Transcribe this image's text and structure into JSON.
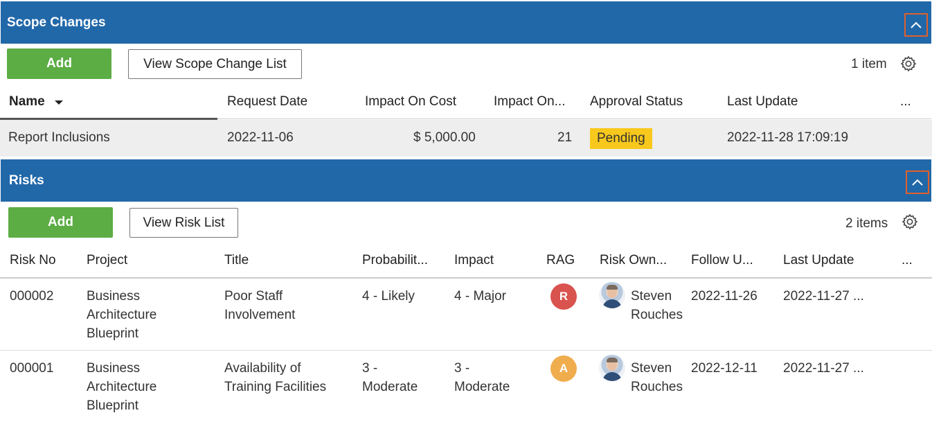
{
  "scope": {
    "title": "Scope Changes",
    "add_label": "Add",
    "view_label": "View Scope Change List",
    "count": "1 item",
    "columns": [
      "Name",
      "Request Date",
      "Impact On Cost",
      "Impact On...",
      "Approval Status",
      "Last Update",
      "..."
    ],
    "rows": [
      {
        "name": "Report Inclusions",
        "request_date": "2022-11-06",
        "impact_cost": "$ 5,000.00",
        "impact_other": "21",
        "status": "Pending",
        "last_update": "2022-11-28 17:09:19"
      }
    ]
  },
  "risks": {
    "title": "Risks",
    "add_label": "Add",
    "view_label": "View Risk List",
    "count": "2 items",
    "columns": [
      "Risk No",
      "Project",
      "Title",
      "Probabilit...",
      "Impact",
      "RAG",
      "Risk Own...",
      "Follow U...",
      "Last Update",
      "..."
    ],
    "rows": [
      {
        "risk_no": "000002",
        "project_1": "Business",
        "project_2": "Architecture",
        "project_3": "Blueprint",
        "title_1": "Poor Staff",
        "title_2": "Involvement",
        "prob_1": "4 - Likely",
        "prob_2": "",
        "impact_1": "4 - Major",
        "impact_2": "",
        "rag": "R",
        "owner_1": "Steven",
        "owner_2": "Rouches",
        "follow_up": "2022-11-26",
        "last_update": "2022-11-27 ..."
      },
      {
        "risk_no": "000001",
        "project_1": "Business",
        "project_2": "Architecture",
        "project_3": "Blueprint",
        "title_1": "Availability of",
        "title_2": "Training Facilities",
        "prob_1": "3 -",
        "prob_2": "Moderate",
        "impact_1": "3 -",
        "impact_2": "Moderate",
        "rag": "A",
        "owner_1": "Steven",
        "owner_2": "Rouches",
        "follow_up": "2022-12-11",
        "last_update": "2022-11-27 ..."
      }
    ]
  },
  "colors": {
    "header_bg": "#2168a9",
    "add_green": "#5cad44",
    "pending_yellow": "#f8c81c",
    "rag_red": "#d9534f",
    "rag_amber": "#f0ad4e",
    "collapse_border": "#e0602a"
  },
  "icons": {
    "collapse": "chevron-up-icon",
    "settings": "gear-icon",
    "sort": "caret-down-icon",
    "avatar": "user-avatar"
  }
}
